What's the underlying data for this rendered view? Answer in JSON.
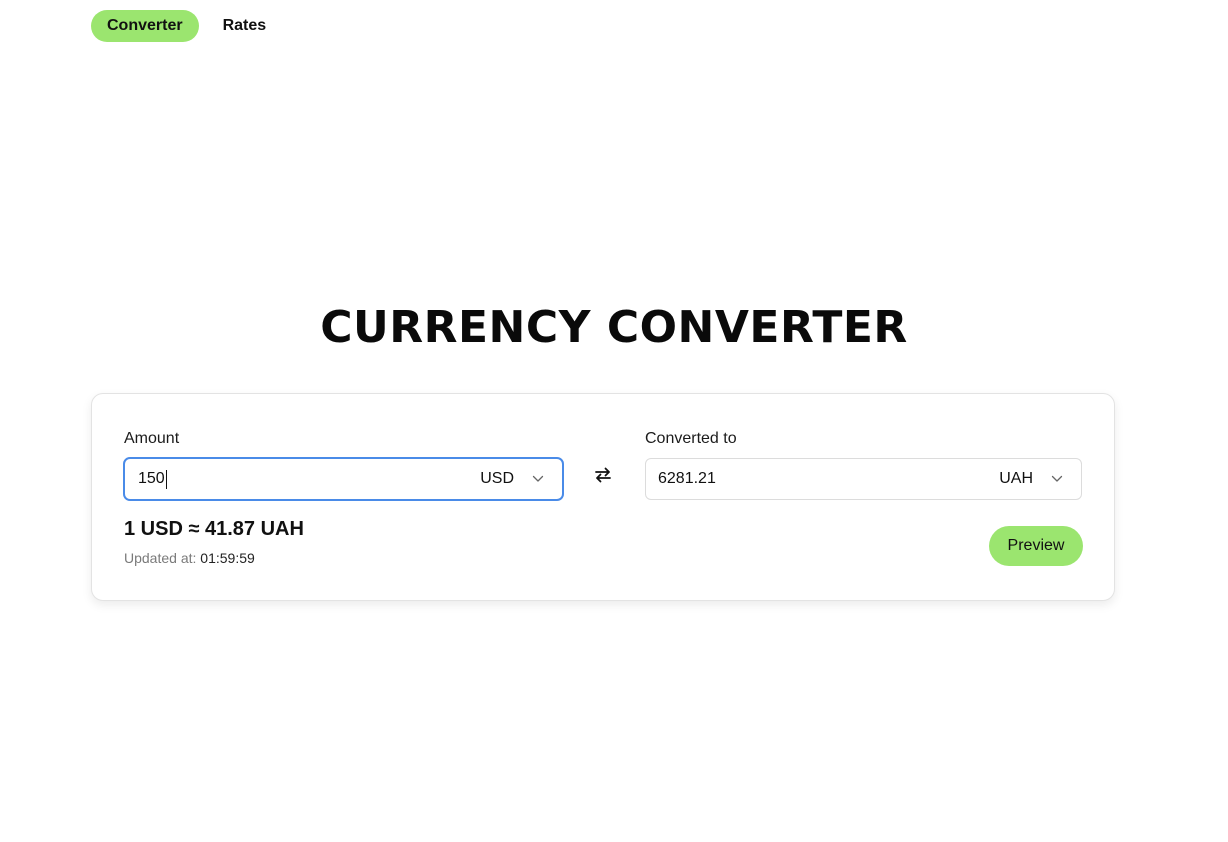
{
  "nav": {
    "tabs": [
      {
        "label": "Converter",
        "active": true
      },
      {
        "label": "Rates",
        "active": false
      }
    ]
  },
  "title": "CURRENCY CONVERTER",
  "converter": {
    "amount": {
      "label": "Amount",
      "value": "150",
      "currency": "USD"
    },
    "converted": {
      "label": "Converted to",
      "value": "6281.21",
      "currency": "UAH"
    },
    "swap_icon": "swap-arrows-icon",
    "rate_text": "1 USD ≈ 41.87 UAH",
    "updated_label": "Updated at:",
    "updated_time": "01:59:59",
    "preview_label": "Preview"
  },
  "colors": {
    "accent": "#9be56f",
    "focus_border": "#4a8be8"
  }
}
